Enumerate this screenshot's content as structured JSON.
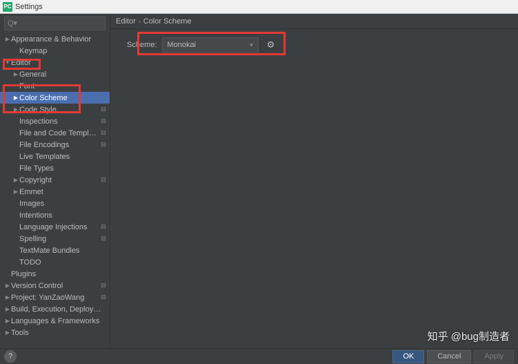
{
  "window": {
    "title": "Settings",
    "app_icon_text": "PC"
  },
  "search": {
    "placeholder": "Q▾"
  },
  "tree": [
    {
      "label": "Appearance & Behavior",
      "indent": 0,
      "arrow": "▶",
      "badge": false,
      "selected": false
    },
    {
      "label": "Keymap",
      "indent": 1,
      "arrow": "",
      "badge": false,
      "selected": false
    },
    {
      "label": "Editor",
      "indent": 0,
      "arrow": "▼",
      "badge": false,
      "selected": false
    },
    {
      "label": "General",
      "indent": 1,
      "arrow": "▶",
      "badge": false,
      "selected": false
    },
    {
      "label": "Font",
      "indent": 1,
      "arrow": "",
      "badge": false,
      "selected": false
    },
    {
      "label": "Color Scheme",
      "indent": 1,
      "arrow": "▶",
      "badge": false,
      "selected": true
    },
    {
      "label": "Code Style",
      "indent": 1,
      "arrow": "▶",
      "badge": true,
      "selected": false
    },
    {
      "label": "Inspections",
      "indent": 1,
      "arrow": "",
      "badge": true,
      "selected": false
    },
    {
      "label": "File and Code Templates",
      "indent": 1,
      "arrow": "",
      "badge": true,
      "selected": false
    },
    {
      "label": "File Encodings",
      "indent": 1,
      "arrow": "",
      "badge": true,
      "selected": false
    },
    {
      "label": "Live Templates",
      "indent": 1,
      "arrow": "",
      "badge": false,
      "selected": false
    },
    {
      "label": "File Types",
      "indent": 1,
      "arrow": "",
      "badge": false,
      "selected": false
    },
    {
      "label": "Copyright",
      "indent": 1,
      "arrow": "▶",
      "badge": true,
      "selected": false
    },
    {
      "label": "Emmet",
      "indent": 1,
      "arrow": "▶",
      "badge": false,
      "selected": false
    },
    {
      "label": "Images",
      "indent": 1,
      "arrow": "",
      "badge": false,
      "selected": false
    },
    {
      "label": "Intentions",
      "indent": 1,
      "arrow": "",
      "badge": false,
      "selected": false
    },
    {
      "label": "Language Injections",
      "indent": 1,
      "arrow": "",
      "badge": true,
      "selected": false
    },
    {
      "label": "Spelling",
      "indent": 1,
      "arrow": "",
      "badge": true,
      "selected": false
    },
    {
      "label": "TextMate Bundles",
      "indent": 1,
      "arrow": "",
      "badge": false,
      "selected": false
    },
    {
      "label": "TODO",
      "indent": 1,
      "arrow": "",
      "badge": false,
      "selected": false
    },
    {
      "label": "Plugins",
      "indent": 0,
      "arrow": "",
      "badge": false,
      "selected": false
    },
    {
      "label": "Version Control",
      "indent": 0,
      "arrow": "▶",
      "badge": true,
      "selected": false
    },
    {
      "label": "Project: YanZaoWang",
      "indent": 0,
      "arrow": "▶",
      "badge": true,
      "selected": false
    },
    {
      "label": "Build, Execution, Deployment",
      "indent": 0,
      "arrow": "▶",
      "badge": false,
      "selected": false
    },
    {
      "label": "Languages & Frameworks",
      "indent": 0,
      "arrow": "▶",
      "badge": false,
      "selected": false
    },
    {
      "label": "Tools",
      "indent": 0,
      "arrow": "▶",
      "badge": false,
      "selected": false
    }
  ],
  "breadcrumb": {
    "part1": "Editor",
    "part2": "Color Scheme"
  },
  "main": {
    "scheme_label": "Scheme:",
    "scheme_value": "Monokai"
  },
  "footer": {
    "help": "?",
    "ok": "OK",
    "cancel": "Cancel",
    "apply": "Apply"
  },
  "watermark": "知乎 @bug制造者"
}
